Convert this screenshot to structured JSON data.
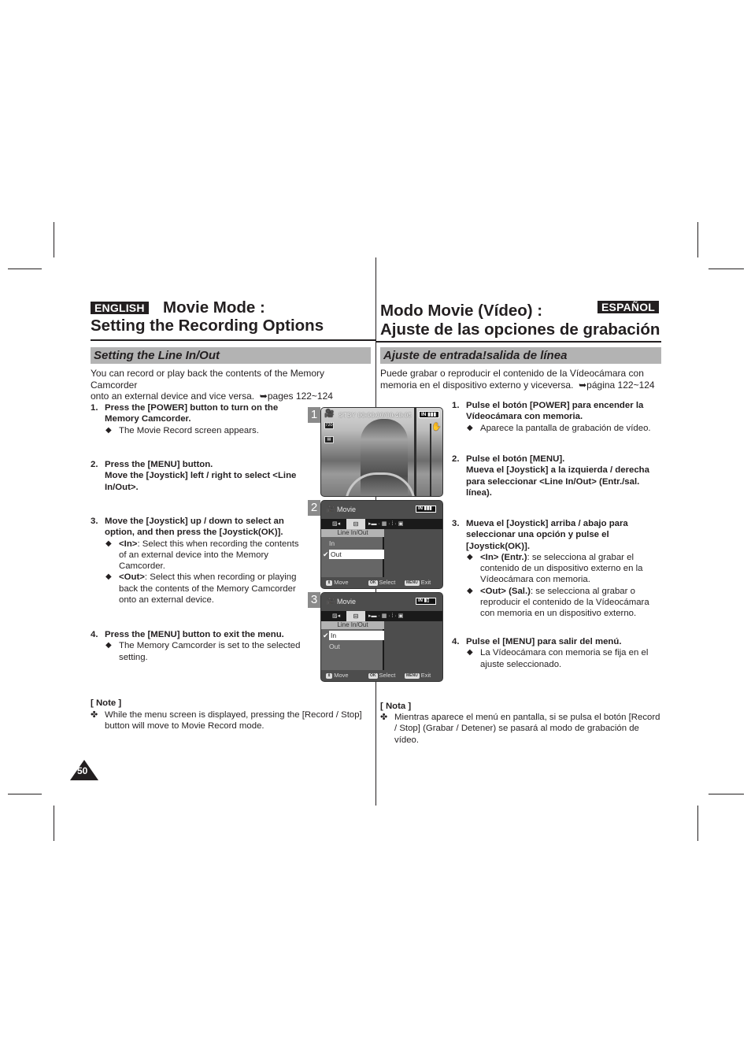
{
  "english": {
    "lang_badge": "ENGLISH",
    "title_line1": "Movie Mode :",
    "title_line2": "Setting the Recording Options",
    "subtitle": "Setting the Line In/Out",
    "intro_line1": "You can record or play back the contents of the Memory Camcorder",
    "intro_line2": "onto an external device and vice versa.",
    "intro_ref": "pages 122~124",
    "steps": [
      {
        "num": "1.",
        "head_lines": [
          "Press the [POWER] button to turn on the",
          "Memory Camcorder."
        ],
        "bullets": [
          {
            "label": "",
            "text": "The Movie Record screen appears."
          }
        ]
      },
      {
        "num": "2.",
        "head_lines": [
          "Press the [MENU] button.",
          "Move the [Joystick] left / right to select <Line",
          "In/Out>."
        ],
        "bullets": []
      },
      {
        "num": "3.",
        "head_lines": [
          "Move the [Joystick] up / down to select an",
          "option, and then press the [Joystick(OK)]."
        ],
        "bullets": [
          {
            "label": "<In>",
            "text": ": Select this when recording the contents of an external device into the Memory Camcorder."
          },
          {
            "label": "<Out>",
            "text": ": Select this when recording or playing back the contents of the Memory Camcorder onto an external device."
          }
        ]
      },
      {
        "num": "4.",
        "head_lines": [
          "Press the [MENU] button to exit the menu."
        ],
        "bullets": [
          {
            "label": "",
            "text": "The Memory Camcorder is set to the selected setting."
          }
        ]
      }
    ],
    "note_heading": "[ Note ]",
    "note_text": "While the menu screen is displayed, pressing the [Record / Stop] button will move to Movie Record mode."
  },
  "spanish": {
    "lang_badge": "ESPAÑOL",
    "title_line1": "Modo Movie (Vídeo) :",
    "title_line2": "Ajuste de las opciones de grabación",
    "subtitle": "Ajuste de entrada!salida de línea",
    "intro_line1": "Puede grabar o reproducir el contenido de la Vídeocámara con",
    "intro_line2": "memoria en el dispositivo externo y viceversa.",
    "intro_ref": "página 122~124",
    "steps": [
      {
        "num": "1.",
        "head_lines": [
          "Pulse el botón [POWER] para encender la",
          "Vídeocámara con memoria."
        ],
        "bullets": [
          {
            "label": "",
            "text": "Aparece la pantalla de grabación de vídeo."
          }
        ]
      },
      {
        "num": "2.",
        "head_lines": [
          "Pulse el botón [MENU].",
          "Mueva el [Joystick] a la izquierda / derecha",
          "para seleccionar <Line In/Out> (Entr./sal.",
          "línea)."
        ],
        "bullets": []
      },
      {
        "num": "3.",
        "head_lines": [
          "Mueva el [Joystick] arriba / abajo para",
          "seleccionar una opción y pulse el",
          "[Joystick(OK)]."
        ],
        "bullets": [
          {
            "label": "<In> (Entr.)",
            "text": ": se selecciona al grabar el contenido de un dispositivo externo en la Vídeocámara con memoria."
          },
          {
            "label": "<Out> (Sal.)",
            "text": ": se selecciona al grabar o reproducir el contenido de la Vídeocámara con memoria en un dispositivo externo."
          }
        ]
      },
      {
        "num": "4.",
        "head_lines": [
          "Pulse el [MENU] para salir del menú."
        ],
        "bullets": [
          {
            "label": "",
            "text": "La Vídeocámara con memoria se fija en el ajuste seleccionado."
          }
        ]
      }
    ],
    "note_heading": "[ Nota ]",
    "note_text": "Mientras aparece el menú en pantalla, si se pulsa el botón [Record / Stop] (Grabar / Detener) se pasará al modo de grabación de vídeo."
  },
  "screens": [
    {
      "num": "1",
      "osd_status": "STBY 00:00:00/00:40:05",
      "battery_label": "IN",
      "quality_icon": "720",
      "icons": [
        "camera-icon",
        "quality-icon",
        "movie-size-icon",
        "stabilizer-icon"
      ]
    },
    {
      "num": "2",
      "mode_title": "Movie",
      "battery_label": "IN",
      "menu_heading": "Line In/Out",
      "options": [
        "In",
        "Out"
      ],
      "selected_option": "Out",
      "keys": [
        {
          "key": "⇕",
          "label": "Move"
        },
        {
          "key": "OK",
          "label": "Select"
        },
        {
          "key": "MENU",
          "label": "Exit"
        }
      ]
    },
    {
      "num": "3",
      "mode_title": "Movie",
      "battery_label": "IN",
      "menu_heading": "Line In/Out",
      "options": [
        "In",
        "Out"
      ],
      "selected_option": "In",
      "keys": [
        {
          "key": "⇕",
          "label": "Move"
        },
        {
          "key": "OK",
          "label": "Select"
        },
        {
          "key": "MENU",
          "label": "Exit"
        }
      ]
    }
  ],
  "arrow_glyph": "➥",
  "bullet_glyph": "◆",
  "note_glyph": "✤",
  "check_glyph": "✔",
  "page_number": "50"
}
